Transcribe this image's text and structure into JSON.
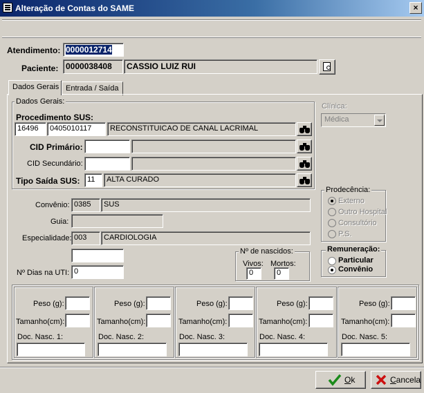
{
  "window": {
    "title": "Alteração de Contas do SAME",
    "close_glyph": "×"
  },
  "header": {
    "atendimento_label": "Atendimento:",
    "atendimento_value": "0000012714",
    "paciente_label": "Paciente:",
    "paciente_code": "0000038408",
    "paciente_name": "CASSIO LUIZ RUI"
  },
  "tabs": [
    {
      "label": "Dados Gerais",
      "active": true
    },
    {
      "label": "Entrada / Saída",
      "active": false
    }
  ],
  "dados_gerais": {
    "group_label": "Dados Gerais:",
    "procedimento_label": "Procedimento SUS:",
    "procedimento_code1": "16496",
    "procedimento_code2": "0405010117",
    "procedimento_desc": "RECONSTITUICAO DE CANAL LACRIMAL",
    "cid_primario_label": "CID Primário:",
    "cid_primario_code": "",
    "cid_primario_desc": "",
    "cid_secundario_label": "CID Secundário:",
    "cid_secundario_code": "",
    "cid_secundario_desc": "",
    "tipo_saida_label": "Tipo Saída SUS:",
    "tipo_saida_code": "11",
    "tipo_saida_desc": "ALTA CURADO"
  },
  "clinica": {
    "label": "Clínica:",
    "value": "Médica"
  },
  "convenio": {
    "label": "Convênio:",
    "code": "0385",
    "name": "SUS"
  },
  "guia": {
    "label": "Guia:",
    "value": ""
  },
  "especialidade": {
    "label": "Especialidade:",
    "code": "003",
    "name": "CARDIOLOGIA"
  },
  "extra_field": {
    "value": ""
  },
  "dias_uti": {
    "label": "Nº Dias na UTI:",
    "value": "0"
  },
  "nascidos": {
    "group_label": "Nº de nascidos:",
    "vivos_label": "Vivos:",
    "vivos_value": "0",
    "mortos_label": "Mortos:",
    "mortos_value": "0"
  },
  "procedencia": {
    "group_label": "Prodecência:",
    "options": [
      {
        "label": "Externo",
        "selected": true
      },
      {
        "label": "Outro Hospital",
        "selected": false
      },
      {
        "label": "Consultório",
        "selected": false
      },
      {
        "label": "P.S.",
        "selected": false
      }
    ]
  },
  "remuneracao": {
    "group_label": "Remuneração:",
    "options": [
      {
        "label": "Particular",
        "selected": false
      },
      {
        "label": "Convênio",
        "selected": true
      }
    ]
  },
  "nascimentos": {
    "peso_label": "Peso (g):",
    "tamanho_label": "Tamanho(cm):",
    "doc_labels": [
      "Doc. Nasc. 1:",
      "Doc. Nasc. 2:",
      "Doc. Nasc. 3:",
      "Doc. Nasc. 4:",
      "Doc. Nasc. 5:"
    ]
  },
  "footer": {
    "ok_prefix": "",
    "ok_accel": "O",
    "ok_rest": "k",
    "cancel_accel": "C",
    "cancel_rest": "ancela",
    "ok_color": "#1a8a1a",
    "cancel_color": "#cc1010"
  }
}
